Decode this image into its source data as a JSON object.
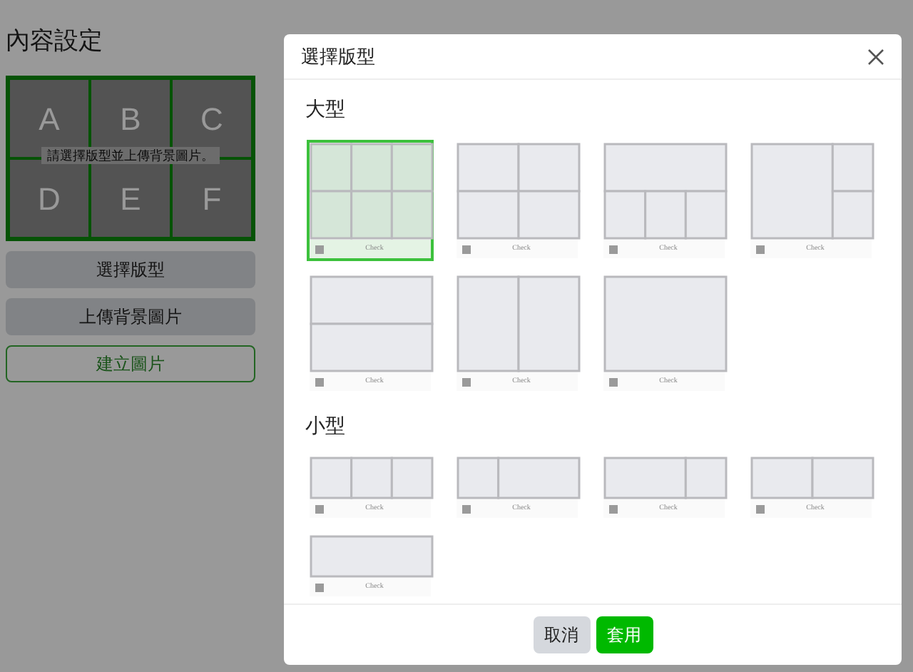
{
  "page": {
    "title": "內容設定",
    "grid_cells": [
      "A",
      "B",
      "C",
      "D",
      "E",
      "F"
    ],
    "grid_hint": "請選擇版型並上傳背景圖片。",
    "buttons": [
      {
        "label": "選擇版型",
        "kind": "filled"
      },
      {
        "label": "上傳背景圖片",
        "kind": "filled"
      },
      {
        "label": "建立圖片",
        "kind": "outline"
      }
    ]
  },
  "dialog": {
    "title": "選擇版型",
    "sections": [
      {
        "heading": "大型",
        "kind": "large",
        "layouts": [
          {
            "kind": "grid6",
            "caption": "Check",
            "selected": true
          },
          {
            "kind": "grid4",
            "caption": "Check",
            "selected": false
          },
          {
            "kind": "topspan",
            "caption": "Check",
            "selected": false
          },
          {
            "kind": "bigleft",
            "caption": "Check",
            "selected": false
          },
          {
            "kind": "rows2",
            "caption": "Check",
            "selected": false
          },
          {
            "kind": "cols2",
            "caption": "Check",
            "selected": false
          },
          {
            "kind": "single",
            "caption": "Check",
            "selected": false
          }
        ]
      },
      {
        "heading": "小型",
        "kind": "small",
        "layouts": [
          {
            "kind": "cols3",
            "caption": "Check",
            "selected": false
          },
          {
            "kind": "narrowwide",
            "caption": "Check",
            "selected": false
          },
          {
            "kind": "widenarrow",
            "caption": "Check",
            "selected": false
          },
          {
            "kind": "cols2",
            "caption": "Check",
            "selected": false
          },
          {
            "kind": "single",
            "caption": "Check",
            "selected": false
          }
        ]
      }
    ],
    "buttons": [
      {
        "label": "取消",
        "kind": "cancel"
      },
      {
        "label": "套用",
        "kind": "primary"
      }
    ]
  }
}
